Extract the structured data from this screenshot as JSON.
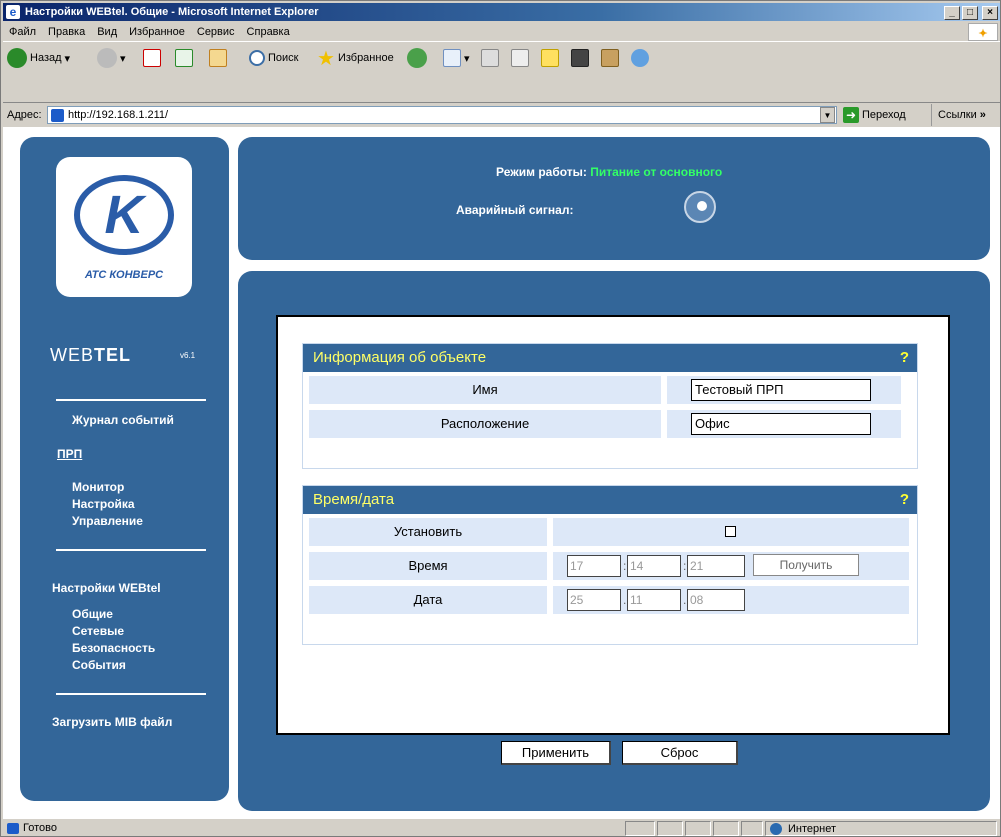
{
  "window": {
    "title": "Настройки WEBtel. Общие - Microsoft Internet Explorer"
  },
  "menu": [
    "Файл",
    "Правка",
    "Вид",
    "Избранное",
    "Сервис",
    "Справка"
  ],
  "toolbar": {
    "back": "Назад",
    "search": "Поиск",
    "favorites": "Избранное"
  },
  "address": {
    "label": "Адрес:",
    "url": "http://192.168.1.211/",
    "go": "Переход",
    "links": "Ссылки"
  },
  "sidebar": {
    "logo_text": "АТС КОНВЕРС",
    "brand_web": "WEB",
    "brand_tel": "TEL",
    "version": "v6.1",
    "journal": "Журнал событий",
    "prp": "ПРП",
    "prp_items": [
      "Монитор",
      "Настройка",
      "Управление"
    ],
    "webtel_settings": "Настройки WEBtel",
    "webtel_items": [
      "Общие",
      "Сетевые",
      "Безопасность",
      "События"
    ],
    "mib": "Загрузить MIB файл"
  },
  "header": {
    "mode_label": "Режим работы:",
    "mode_value": "Питание от основного",
    "alarm_label": "Аварийный сигнал:"
  },
  "object_info": {
    "title": "Информация об объекте",
    "help": "?",
    "name_label": "Имя",
    "name_value": "Тестовый ПРП",
    "location_label": "Расположение",
    "location_value": "Офис"
  },
  "time_date": {
    "title": "Время/дата",
    "help": "?",
    "set_label": "Установить",
    "time_label": "Время",
    "hh": "17",
    "mm": "14",
    "ss": "21",
    "get": "Получить",
    "date_label": "Дата",
    "dd": "25",
    "mo": "11",
    "yy": "08"
  },
  "buttons": {
    "apply": "Применить",
    "reset": "Сброс"
  },
  "status": {
    "left": "Готово",
    "zone": "Интернет"
  }
}
